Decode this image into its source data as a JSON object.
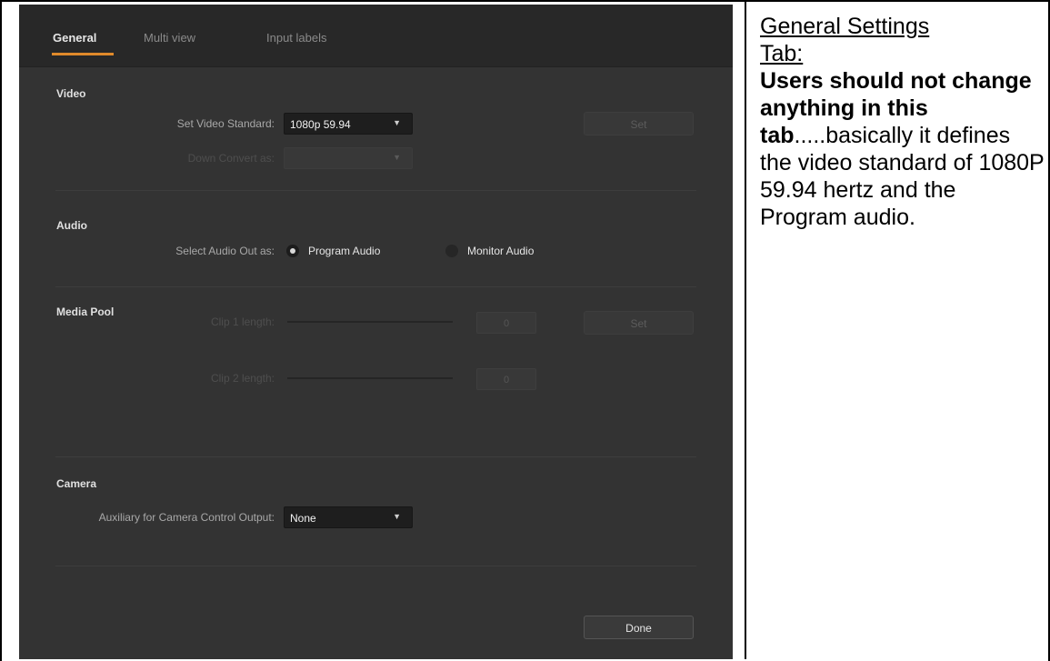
{
  "app": {
    "tabs": [
      {
        "label": "General",
        "active": true
      },
      {
        "label": "Multi view",
        "active": false
      },
      {
        "label": "Input labels",
        "active": false
      }
    ],
    "video": {
      "title": "Video",
      "standard_label": "Set Video Standard:",
      "standard_value": "1080p 59.94",
      "down_convert_label": "Down Convert as:",
      "down_convert_value": "",
      "set_label": "Set"
    },
    "audio": {
      "title": "Audio",
      "out_label": "Select Audio Out as:",
      "options": [
        {
          "label": "Program Audio",
          "selected": true
        },
        {
          "label": "Monitor Audio",
          "selected": false
        }
      ]
    },
    "media_pool": {
      "title": "Media Pool",
      "clip1_label": "Clip 1 length:",
      "clip1_value": "0",
      "clip2_label": "Clip 2 length:",
      "clip2_value": "0",
      "set_label": "Set"
    },
    "camera": {
      "title": "Camera",
      "aux_label": "Auxiliary for Camera Control Output:",
      "aux_value": "None"
    },
    "done_label": "Done",
    "colors": {
      "accent": "#e08a2b",
      "panel": "#333333",
      "tabbar": "#282828"
    }
  },
  "notes": {
    "heading_line1": "General Settings",
    "heading_line2": "Tab:",
    "bold_text": "Users should not change anything in this tab",
    "rest_text": ".....basically it defines the video standard of 1080P 59.94 hertz and the Program audio."
  }
}
